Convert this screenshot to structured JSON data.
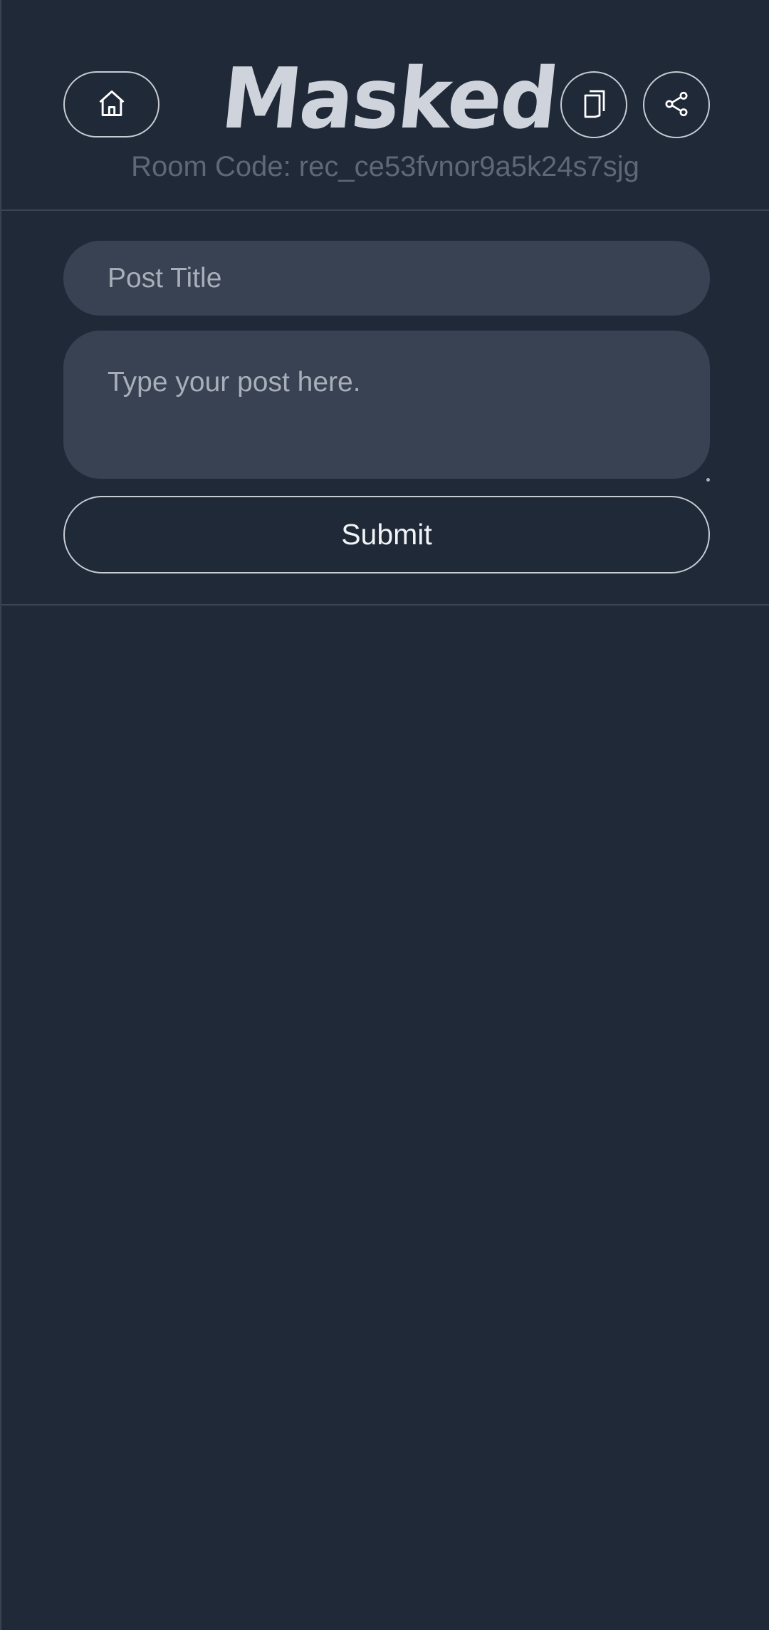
{
  "header": {
    "logo_text": "Masked",
    "room_code": "Room Code: rec_ce53fvnor9a5k24s7sjg",
    "buttons": {
      "home_icon": "home-icon",
      "copy_icon": "copy-icon",
      "share_icon": "share-icon"
    }
  },
  "form": {
    "title_placeholder": "Post Title",
    "title_value": "",
    "body_placeholder": "Type your post here.",
    "body_value": "",
    "submit_label": "Submit"
  },
  "colors": {
    "background": "#202938",
    "input_background": "#384252",
    "border": "#c7cbd3",
    "muted_text": "#5f6877"
  }
}
